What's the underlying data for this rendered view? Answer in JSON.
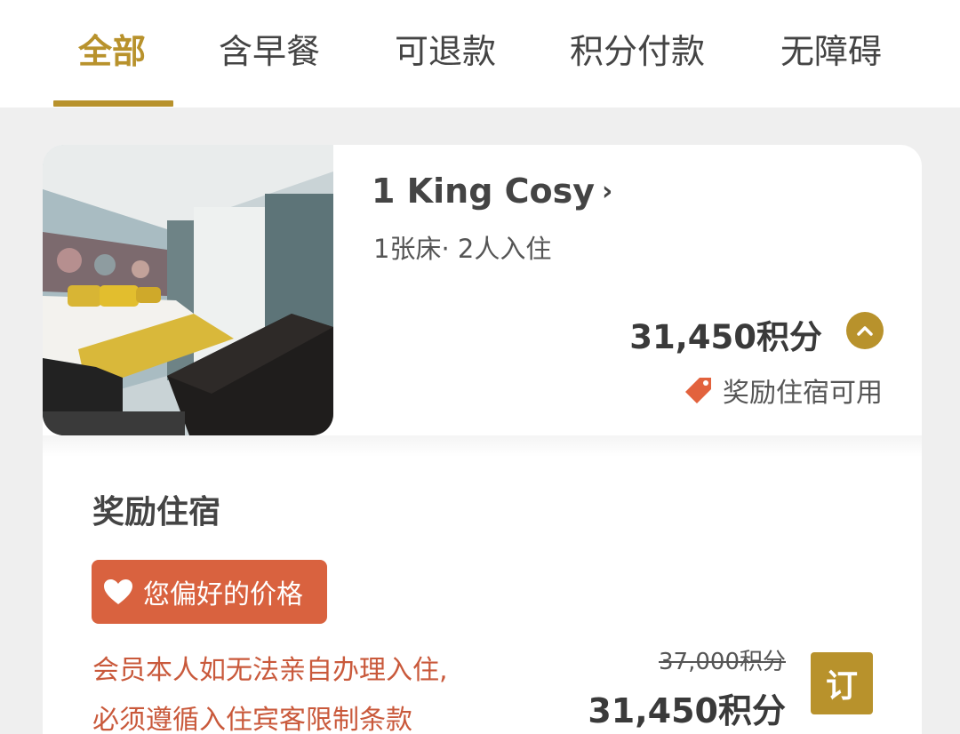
{
  "tabs": [
    {
      "label": "全部",
      "active": true
    },
    {
      "label": "含早餐",
      "active": false
    },
    {
      "label": "可退款",
      "active": false
    },
    {
      "label": "积分付款",
      "active": false
    },
    {
      "label": "无障碍",
      "active": false
    }
  ],
  "room": {
    "title": "1 King Cosy",
    "chevron": "›",
    "meta": "1张床· 2人入住",
    "price": "31,450积分",
    "tag": "奖励住宿可用",
    "tag_icon": "price-tag-icon",
    "collapse_icon": "chevron-up-icon"
  },
  "rate": {
    "section_title": "奖励住宿",
    "badge_label": "您偏好的价格",
    "badge_icon": "heart-icon",
    "policy_line1": "会员本人如无法亲自办理入住,",
    "policy_line2": "必须遵循入住宾客限制条款",
    "original_price": "37,000积分",
    "price": "31,450积分",
    "book_label": "订"
  },
  "colors": {
    "accent": "#b8922c",
    "badge": "#d9623f",
    "policy_text": "#c9593b",
    "background": "#efefef"
  }
}
